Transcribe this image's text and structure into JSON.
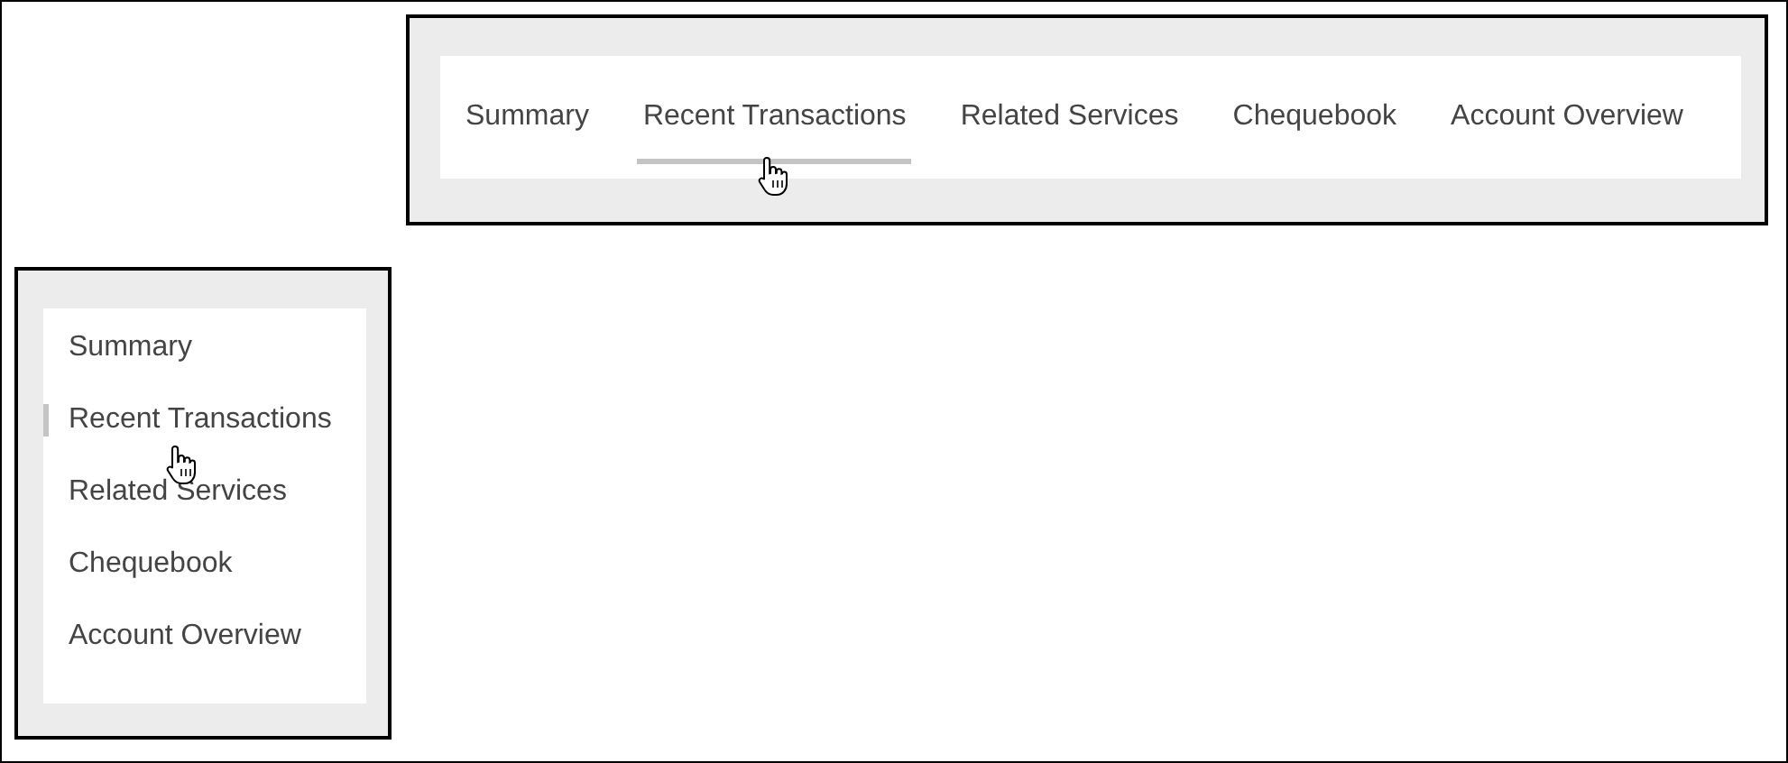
{
  "horizontal_tabs": [
    {
      "label": "Summary",
      "selected": false
    },
    {
      "label": "Recent Transactions",
      "selected": true
    },
    {
      "label": "Related Services",
      "selected": false
    },
    {
      "label": "Chequebook",
      "selected": false
    },
    {
      "label": "Account Overview",
      "selected": false
    }
  ],
  "vertical_tabs": [
    {
      "label": "Summary",
      "selected": false
    },
    {
      "label": "Recent Transactions",
      "selected": true
    },
    {
      "label": "Related Services",
      "selected": false
    },
    {
      "label": "Chequebook",
      "selected": false
    },
    {
      "label": "Account Overview",
      "selected": false
    }
  ]
}
